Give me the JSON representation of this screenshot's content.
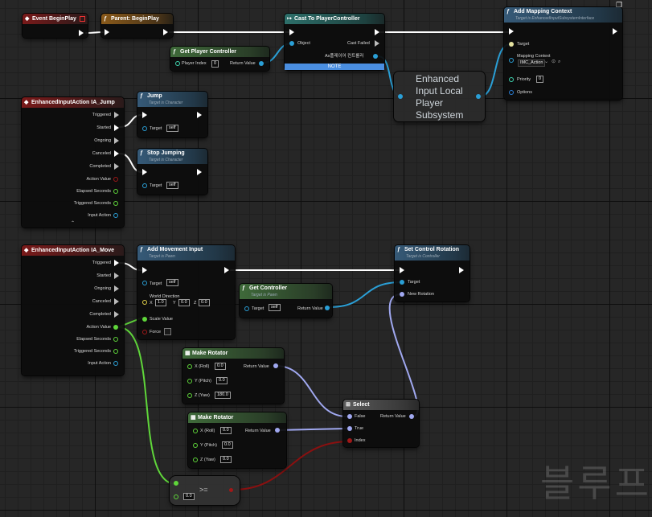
{
  "nodes": {
    "event_beginplay": {
      "title": "Event BeginPlay"
    },
    "parent_beginplay": {
      "title": "Parent: BeginPlay"
    },
    "cast": {
      "title": "Cast To PlayerController",
      "object": "Object",
      "cast_failed": "Cast Failed",
      "as_pc": "As플레이어 컨트롤러",
      "note": "NOTE"
    },
    "get_pc": {
      "title": "Get Player Controller",
      "player_index": "Player Index",
      "player_index_val": "0",
      "return_value": "Return Value"
    },
    "add_mapping": {
      "title": "Add Mapping Context",
      "subtitle": "Target is EnhancedInputSubsystemInterface",
      "target": "Target",
      "mapping_context": "Mapping Context",
      "mapping_value": "IMC_Action",
      "priority": "Priority",
      "priority_val": "0",
      "options": "Options"
    },
    "subsystem": {
      "title": "Enhanced Input Local Player Subsystem"
    },
    "ia_jump": {
      "title": "EnhancedInputAction IA_Jump",
      "triggered": "Triggered",
      "started": "Started",
      "ongoing": "Ongoing",
      "canceled": "Canceled",
      "completed": "Completed",
      "action_value": "Action Value",
      "elapsed": "Elapsed Seconds",
      "triggered_sec": "Triggered Seconds",
      "input_action": "Input Action"
    },
    "jump": {
      "title": "Jump",
      "subtitle": "Target is Character",
      "target": "Target",
      "target_val": "self"
    },
    "stop_jumping": {
      "title": "Stop Jumping",
      "subtitle": "Target is Character",
      "target": "Target",
      "target_val": "self"
    },
    "ia_move": {
      "title": "EnhancedInputAction IA_Move",
      "triggered": "Triggered",
      "started": "Started",
      "ongoing": "Ongoing",
      "canceled": "Canceled",
      "completed": "Completed",
      "action_value": "Action Value",
      "elapsed": "Elapsed Seconds",
      "triggered_sec": "Triggered Seconds",
      "input_action": "Input Action"
    },
    "add_movement": {
      "title": "Add Movement Input",
      "subtitle": "Target is Pawn",
      "target": "Target",
      "target_val": "self",
      "world_direction": "World Direction",
      "x_label": "X",
      "x_val": "1.0",
      "y_label": "Y",
      "y_val": "0.0",
      "z_label": "Z",
      "z_val": "0.0",
      "scale_value": "Scale Value",
      "force": "Force"
    },
    "get_controller": {
      "title": "Get Controller",
      "subtitle": "Target is Pawn",
      "target": "Target",
      "target_val": "self",
      "return_value": "Return Value"
    },
    "set_control_rotation": {
      "title": "Set Control Rotation",
      "subtitle": "Target is Controller",
      "target": "Target",
      "new_rotation": "New Rotation"
    },
    "make_rotator_1": {
      "title": "Make Rotator",
      "x": "X (Roll)",
      "x_val": "0.0",
      "y": "Y (Pitch)",
      "y_val": "0.0",
      "z": "Z (Yaw)",
      "z_val": "180.0",
      "return_value": "Return Value"
    },
    "make_rotator_2": {
      "title": "Make Rotator",
      "x": "X (Roll)",
      "x_val": "0.0",
      "y": "Y (Pitch)",
      "y_val": "0.0",
      "z": "Z (Yaw)",
      "z_val": "0.0",
      "return_value": "Return Value"
    },
    "select": {
      "title": "Select",
      "false": "False",
      "true": "True",
      "index": "Index",
      "return_value": "Return Value"
    },
    "compare": {
      "title": ">=",
      "b_val": "0.0"
    }
  },
  "watermark": "블루프",
  "colors": {
    "exec": "#ffffff",
    "object": "#2a9fd6",
    "float": "#5fd63a",
    "struct_rotator": "#a0a8f0",
    "bool": "#a01818",
    "event_header": "#7a1a1a",
    "function_header": "#365a78",
    "note": "#4a8ee0"
  }
}
